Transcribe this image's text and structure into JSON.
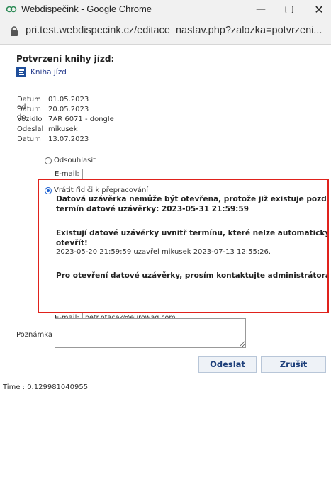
{
  "window": {
    "title": "Webdispečink - Google Chrome",
    "minimize": "—",
    "maximize": "▢",
    "close": "✕"
  },
  "address": {
    "url": "pri.test.webdispecink.cz/editace_nastav.php?zalozka=potvrzeni..."
  },
  "page": {
    "title": "Potvrzení knihy jízd:",
    "book_link": "Kniha jízd"
  },
  "fields": [
    {
      "label": "Datum od",
      "value": "01.05.2023"
    },
    {
      "label": "Datum do",
      "value": "20.05.2023"
    },
    {
      "label": "Vozidlo",
      "value": "7AR 6071 - dongle"
    },
    {
      "label": "Odeslal",
      "value": "mikusek"
    },
    {
      "label": "Datum",
      "value": "13.07.2023"
    }
  ],
  "options": {
    "disagree_label": "Odsouhlasit",
    "return_label": "Vrátit řidiči k přepracování",
    "selected": "return"
  },
  "email": {
    "label": "E-mail:",
    "value1": "",
    "value2": "petr.ptacek@eurowag.com"
  },
  "alert": {
    "line1": "Datová uzávěrka nemůže být otevřena, protože již existuje pozdější",
    "line2": "termín datové uzávěrky: 2023-05-31 21:59:59",
    "line3": "Existují datové uzávěrky uvnitř termínu, které nelze automaticky",
    "line4": "otevřít!",
    "line5": "2023-05-20 21:59:59 uzavřel mikusek 2023-07-13 12:55:26.",
    "line6": "Pro otevření datové uzávěrky, prosím kontaktujte administrátora!"
  },
  "note": {
    "label": "Poznámka",
    "value": ""
  },
  "buttons": {
    "send": "Odeslat",
    "cancel": "Zrušit"
  },
  "footer": {
    "time": "Time : 0.129981040955"
  },
  "colors": {
    "alert_border": "#e0221c",
    "link": "#2a3f8f",
    "button_text": "#1d3f7a"
  }
}
